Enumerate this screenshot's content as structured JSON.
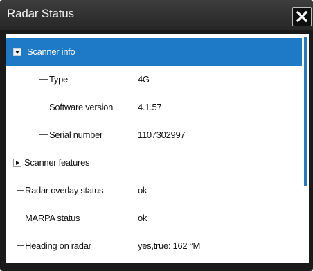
{
  "window": {
    "title": "Radar Status"
  },
  "tree": {
    "scanner_info": {
      "label": "Scanner info",
      "expanded": true,
      "children": [
        {
          "label": "Type",
          "value": "4G"
        },
        {
          "label": "Software version",
          "value": "4.1.57"
        },
        {
          "label": "Serial number",
          "value": "1107302997"
        }
      ]
    },
    "scanner_features": {
      "label": "Scanner features",
      "expanded": false
    },
    "items": [
      {
        "label": "Radar overlay status",
        "value": "ok"
      },
      {
        "label": "MARPA status",
        "value": "ok"
      },
      {
        "label": "Heading on radar",
        "value": "yes,true: 162 °M"
      }
    ]
  },
  "icons": {
    "close": "close-x-icon",
    "expanded": "triangle-down-icon",
    "collapsed": "triangle-right-icon"
  },
  "colors": {
    "accent": "#1e79c6",
    "titlebar": "#2e2e2e",
    "frame": "#1a1a1a"
  }
}
